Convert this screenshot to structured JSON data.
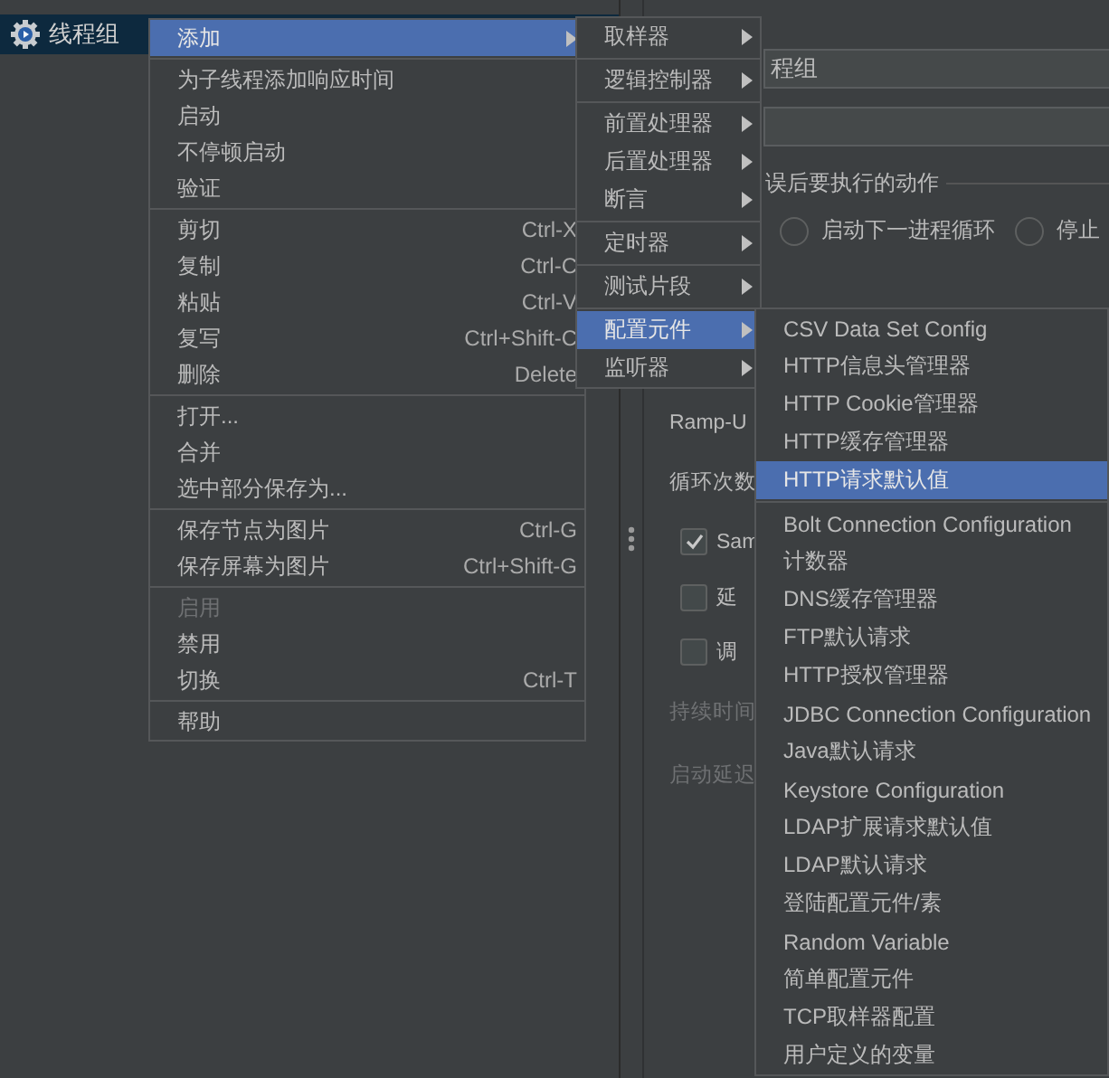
{
  "tree": {
    "items": [
      {
        "label": "线程组",
        "selected": true
      }
    ]
  },
  "panel": {
    "name_field": {
      "value": "程组"
    },
    "section_label": "误后要执行的动作",
    "radios": [
      {
        "label": "启动下一进程循环",
        "selected": false
      },
      {
        "label": "停止",
        "selected": false
      }
    ],
    "rows": [
      {
        "kind": "label",
        "label": "Ramp-U",
        "disabled": false
      },
      {
        "kind": "label",
        "label": "循环次数",
        "disabled": false
      },
      {
        "kind": "checkbox",
        "label": "Sam",
        "checked": true
      },
      {
        "kind": "checkbox",
        "label": "延",
        "checked": false
      },
      {
        "kind": "checkbox",
        "label": "调",
        "checked": false
      },
      {
        "kind": "label",
        "label": "持续时间",
        "disabled": true
      },
      {
        "kind": "label",
        "label": "启动延迟",
        "disabled": true
      }
    ]
  },
  "context_menu": {
    "groups": [
      [
        {
          "label": "添加",
          "submenu": true,
          "selected": true,
          "disabled": false
        }
      ],
      [
        {
          "label": "为子线程添加响应时间",
          "submenu": false,
          "selected": false,
          "disabled": false
        },
        {
          "label": "启动",
          "submenu": false,
          "selected": false,
          "disabled": false
        },
        {
          "label": "不停顿启动",
          "submenu": false,
          "selected": false,
          "disabled": false
        },
        {
          "label": "验证",
          "submenu": false,
          "selected": false,
          "disabled": false
        }
      ],
      [
        {
          "label": "剪切",
          "shortcut": "Ctrl-X",
          "submenu": false,
          "selected": false,
          "disabled": false
        },
        {
          "label": "复制",
          "shortcut": "Ctrl-C",
          "submenu": false,
          "selected": false,
          "disabled": false
        },
        {
          "label": "粘贴",
          "shortcut": "Ctrl-V",
          "submenu": false,
          "selected": false,
          "disabled": false
        },
        {
          "label": "复写",
          "shortcut": "Ctrl+Shift-C",
          "submenu": false,
          "selected": false,
          "disabled": false
        },
        {
          "label": "删除",
          "shortcut": "Delete",
          "submenu": false,
          "selected": false,
          "disabled": false
        }
      ],
      [
        {
          "label": "打开...",
          "submenu": false,
          "selected": false,
          "disabled": false
        },
        {
          "label": "合并",
          "submenu": false,
          "selected": false,
          "disabled": false
        },
        {
          "label": "选中部分保存为...",
          "submenu": false,
          "selected": false,
          "disabled": false
        }
      ],
      [
        {
          "label": "保存节点为图片",
          "shortcut": "Ctrl-G",
          "submenu": false,
          "selected": false,
          "disabled": false
        },
        {
          "label": "保存屏幕为图片",
          "shortcut": "Ctrl+Shift-G",
          "submenu": false,
          "selected": false,
          "disabled": false
        }
      ],
      [
        {
          "label": "启用",
          "submenu": false,
          "selected": false,
          "disabled": true
        },
        {
          "label": "禁用",
          "submenu": false,
          "selected": false,
          "disabled": false
        },
        {
          "label": "切换",
          "shortcut": "Ctrl-T",
          "submenu": false,
          "selected": false,
          "disabled": false
        }
      ],
      [
        {
          "label": "帮助",
          "submenu": false,
          "selected": false,
          "disabled": false
        }
      ]
    ]
  },
  "add_submenu": {
    "groups": [
      [
        {
          "label": "取样器",
          "submenu": true,
          "selected": false
        }
      ],
      [
        {
          "label": "逻辑控制器",
          "submenu": true,
          "selected": false
        }
      ],
      [
        {
          "label": "前置处理器",
          "submenu": true,
          "selected": false
        },
        {
          "label": "后置处理器",
          "submenu": true,
          "selected": false
        },
        {
          "label": "断言",
          "submenu": true,
          "selected": false
        }
      ],
      [
        {
          "label": "定时器",
          "submenu": true,
          "selected": false
        }
      ],
      [
        {
          "label": "测试片段",
          "submenu": true,
          "selected": false
        }
      ],
      [
        {
          "label": "配置元件",
          "submenu": true,
          "selected": true
        },
        {
          "label": "监听器",
          "submenu": true,
          "selected": false
        }
      ]
    ]
  },
  "config_submenu": {
    "groups": [
      [
        {
          "label": "CSV Data Set Config",
          "selected": false
        },
        {
          "label": "HTTP信息头管理器",
          "selected": false
        },
        {
          "label": "HTTP Cookie管理器",
          "selected": false
        },
        {
          "label": "HTTP缓存管理器",
          "selected": false
        },
        {
          "label": "HTTP请求默认值",
          "selected": true
        }
      ],
      [
        {
          "label": "Bolt Connection Configuration",
          "selected": false
        },
        {
          "label": "计数器",
          "selected": false
        },
        {
          "label": "DNS缓存管理器",
          "selected": false
        },
        {
          "label": "FTP默认请求",
          "selected": false
        },
        {
          "label": "HTTP授权管理器",
          "selected": false
        },
        {
          "label": "JDBC Connection Configuration",
          "selected": false
        },
        {
          "label": "Java默认请求",
          "selected": false
        },
        {
          "label": "Keystore Configuration",
          "selected": false
        },
        {
          "label": "LDAP扩展请求默认值",
          "selected": false
        },
        {
          "label": "LDAP默认请求",
          "selected": false
        },
        {
          "label": "登陆配置元件/素",
          "selected": false
        },
        {
          "label": "Random Variable",
          "selected": false
        },
        {
          "label": "简单配置元件",
          "selected": false
        },
        {
          "label": "TCP取样器配置",
          "selected": false
        },
        {
          "label": "用户定义的变量",
          "selected": false
        }
      ]
    ]
  }
}
